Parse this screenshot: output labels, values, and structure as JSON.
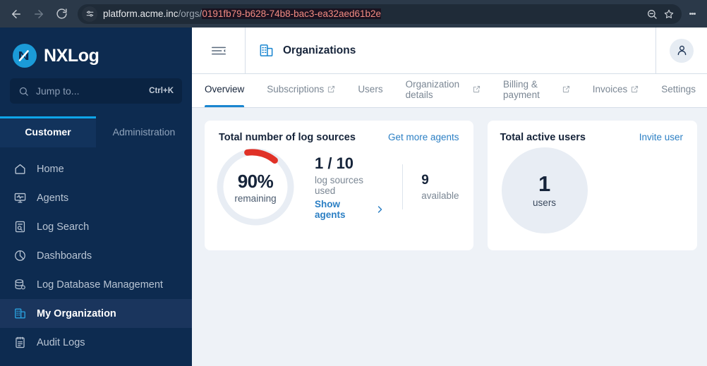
{
  "browser": {
    "back_icon": "back-arrow-icon",
    "forward_icon": "forward-arrow-icon",
    "reload_icon": "reload-icon",
    "site_info_icon": "site-settings-icon",
    "url_host": "platform.acme.inc",
    "url_path": "/orgs/",
    "url_selected": "0191fb79-b628-74b8-bac3-ea32aed61b2e",
    "zoom_out_icon": "zoom-out-icon",
    "bookmark_icon": "star-icon",
    "menu_icon": "three-dot-menu-icon"
  },
  "sidebar": {
    "brand": "NXLog",
    "search": {
      "placeholder": "Jump to...",
      "shortcut": "Ctrl+K"
    },
    "tabs": [
      {
        "label": "Customer",
        "active": true
      },
      {
        "label": "Administration",
        "active": false
      }
    ],
    "items": [
      {
        "label": "Home",
        "icon": "home-icon",
        "active": false
      },
      {
        "label": "Agents",
        "icon": "agents-monitor-icon",
        "active": false
      },
      {
        "label": "Log Search",
        "icon": "log-search-icon",
        "active": false
      },
      {
        "label": "Dashboards",
        "icon": "dashboards-pie-icon",
        "active": false
      },
      {
        "label": "Log Database Management",
        "icon": "database-icon",
        "active": false
      },
      {
        "label": "My Organization",
        "icon": "organization-building-icon",
        "active": true
      },
      {
        "label": "Audit Logs",
        "icon": "audit-logs-clipboard-icon",
        "active": false
      }
    ]
  },
  "topbar": {
    "collapse_icon": "collapse-sidebar-icon",
    "page_icon": "organizations-building-icon",
    "title": "Organizations",
    "avatar_icon": "user-avatar-icon"
  },
  "tabs": [
    {
      "label": "Overview",
      "external": false,
      "active": true
    },
    {
      "label": "Subscriptions",
      "external": true,
      "active": false
    },
    {
      "label": "Users",
      "external": false,
      "active": false
    },
    {
      "label": "Organization details",
      "external": true,
      "active": false
    },
    {
      "label": "Billing & payment",
      "external": true,
      "active": false
    },
    {
      "label": "Invoices",
      "external": true,
      "active": false
    },
    {
      "label": "Settings",
      "external": false,
      "active": false
    }
  ],
  "cards": {
    "log_sources": {
      "title": "Total number of log sources",
      "action": "Get more agents",
      "donut_percent": "90%",
      "donut_sub": "remaining",
      "used_value": "1 / 10",
      "used_label": "log sources used",
      "show_agents": "Show agents",
      "available_value": "9",
      "available_label": "available"
    },
    "active_users": {
      "title": "Total active users",
      "action": "Invite user",
      "count": "1",
      "count_label": "users"
    }
  },
  "chart_data": [
    {
      "type": "pie",
      "title": "Total number of log sources",
      "categories": [
        "used",
        "remaining"
      ],
      "values": [
        10,
        90
      ],
      "unit": "percent",
      "colors": [
        "#e03127",
        "#e8edf4"
      ],
      "center_label": "90% remaining"
    },
    {
      "type": "pie",
      "title": "Total active users",
      "categories": [
        "users"
      ],
      "values": [
        1
      ],
      "colors": [
        "#e8edf4"
      ],
      "center_label": "1 users"
    }
  ],
  "colors": {
    "brand_navy": "#0d2b50",
    "accent_blue": "#1a86d0",
    "logo_blue": "#1b9bd8",
    "alert_red": "#e03127",
    "content_bg": "#eef2f7"
  }
}
